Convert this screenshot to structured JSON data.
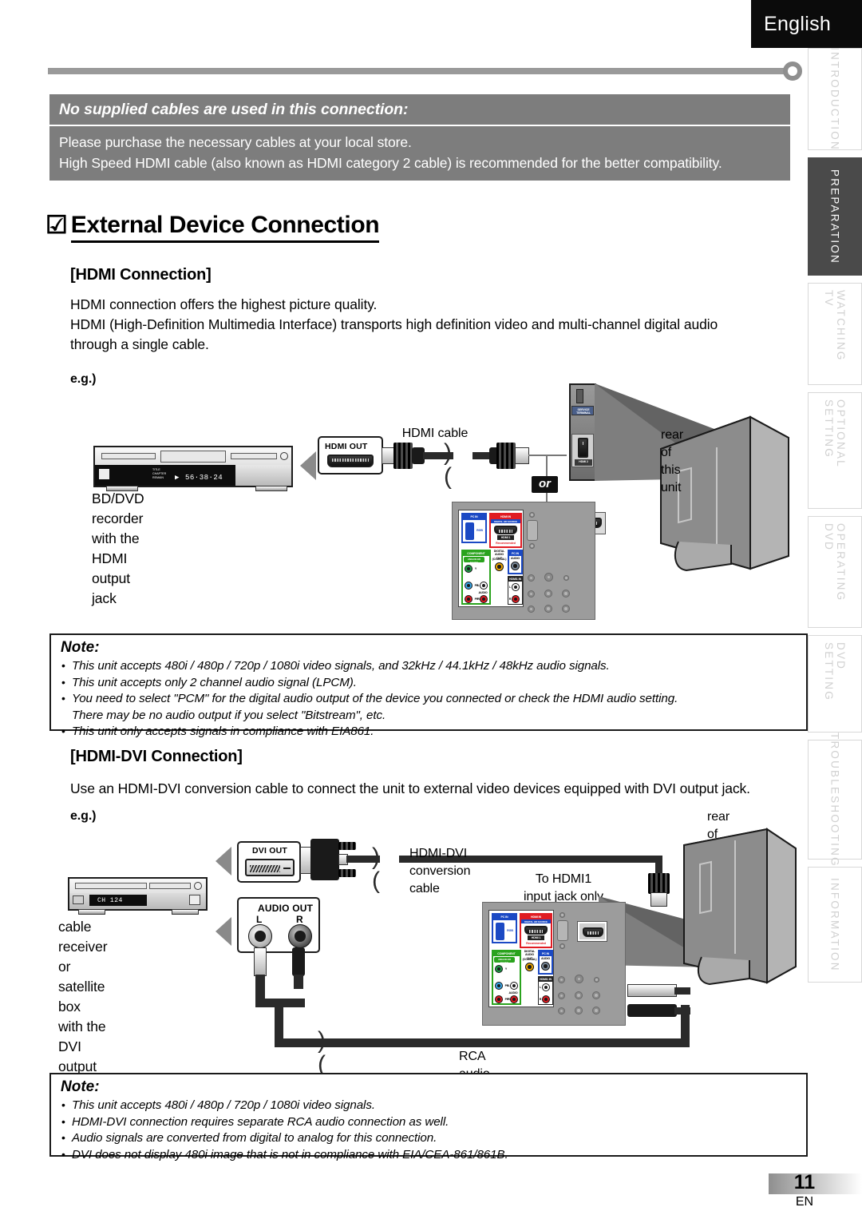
{
  "language_tab": "English",
  "notice": {
    "title": "No supplied cables are used in this connection:",
    "line1": "Please purchase the necessary cables at your local store.",
    "line2": "High Speed HDMI cable (also known as HDMI category 2 cable) is recommended for the better compatibility."
  },
  "heading": {
    "check_icon": "☑",
    "text": "External Device Connection"
  },
  "hdmi_section": {
    "title": "[HDMI Connection]",
    "para1": "HDMI connection offers the highest picture quality.",
    "para2": "HDMI (High-Definition Multimedia Interface) transports high definition video and multi-channel digital audio",
    "para3": "through a single cable.",
    "eg": "e.g.)"
  },
  "diagram1": {
    "recorder_label_line1": "BD/DVD recorder",
    "recorder_label_line2": "with the HDMI output jack",
    "recorder_display_time": "56·38·24",
    "recorder_display_play": "▶",
    "recorder_tiny1": "TITLE",
    "recorder_tiny2": "CHAPTER",
    "recorder_tiny3": "REMAIN",
    "jack_label": "HDMI OUT",
    "cable_label": "HDMI cable",
    "rear_label": "rear of this unit",
    "or_badge": "or",
    "service_terminal": "SERVICE TERMINAL",
    "hdmi2_label": "HDMI 2",
    "panel": {
      "pc_in": "PC IN",
      "pc_in_rgb": "RGB",
      "hdmi_in": "HDMI IN",
      "hdmi_in_sub": "DIGITAL HD SOURCE",
      "hdmi1": "HDMI 1",
      "recommended": "Recommended",
      "component": "COMPONENT",
      "component_sub": "ANALOG HD Capable",
      "digital_audio_out": "DIGITAL AUDIO OUT",
      "coaxial": "(COAXIAL)",
      "pc_in_audio_title": "PC IN",
      "audio": "AUDIO",
      "hdmi1_in": "HDMI1 IN",
      "y": "Y",
      "pb": "PB",
      "pr": "PR",
      "l": "L",
      "r": "R",
      "audio_small": "AUDIO"
    }
  },
  "hdmidvi_section": {
    "title": "[HDMI-DVI Connection]",
    "para1": "Use an HDMI-DVI conversion cable to connect the unit to external video devices equipped with DVI output jack.",
    "eg": "e.g.)"
  },
  "diagram2": {
    "receiver_label_line1": "cable receiver or satellite box",
    "receiver_label_line2": "with the DVI output jack",
    "receiver_display": "CH 124",
    "dvi_out_label": "DVI OUT",
    "audio_out_label": "AUDIO OUT",
    "audio_left": "L",
    "audio_right": "R",
    "conversion_cable_label": "HDMI-DVI conversion cable",
    "to_hdmi1_line1": "To HDMI1",
    "to_hdmi1_line2": "input jack only",
    "rca_cable_label": "RCA audio cable",
    "rear_label": "rear of this unit"
  },
  "note1": {
    "title": "Note:",
    "items": [
      "This unit accepts 480i / 480p / 720p / 1080i video signals, and 32kHz / 44.1kHz / 48kHz audio signals.",
      "This unit accepts only 2 channel audio signal (LPCM).",
      "You need to select \"PCM\" for the digital audio output of the device you connected or check the HDMI audio setting.",
      "There may be no audio output if you select \"Bitstream\", etc.",
      "This unit only accepts signals in compliance with EIA861."
    ],
    "continuation_index": 3
  },
  "note2": {
    "title": "Note:",
    "items": [
      "This unit accepts 480i / 480p / 720p / 1080i video signals.",
      "HDMI-DVI connection requires separate RCA audio connection as well.",
      "Audio signals are converted from digital to analog for this connection.",
      "DVI does not display 480i image that is not in compliance with EIA/CEA-861/861B."
    ],
    "continuation_index": -1
  },
  "side_tabs": [
    {
      "label": "INTRODUCTION",
      "active": false
    },
    {
      "label": "PREPARATION",
      "active": true
    },
    {
      "label": "WATCHING TV",
      "active": false
    },
    {
      "label": "OPTIONAL SETTING",
      "active": false
    },
    {
      "label": "OPERATING DVD",
      "active": false
    },
    {
      "label": "DVD SETTING",
      "active": false
    },
    {
      "label": "TROUBLESHOOTING",
      "active": false
    },
    {
      "label": "INFORMATION",
      "active": false
    }
  ],
  "footer": {
    "page_number": "11",
    "lang_code": "EN"
  },
  "colors": {
    "notice_bg": "#7d7d7d",
    "tab_active_bg": "#4a4a4a",
    "port_red": "#e01b22",
    "port_blue": "#1b49c4",
    "port_green": "#2aa31d"
  }
}
